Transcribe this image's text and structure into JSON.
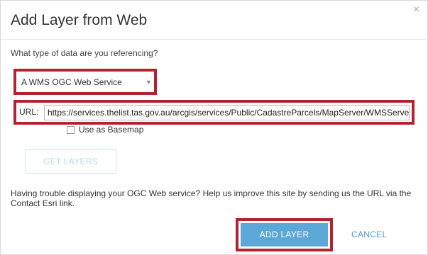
{
  "dialog": {
    "title": "Add Layer from Web",
    "close_glyph": "×",
    "question": "What type of data are you referencing?",
    "select": {
      "selected": "A WMS OGC Web Service",
      "caret_glyph": "▼"
    },
    "url": {
      "label": "URL:",
      "value": "https://services.thelist.tas.gov.au/arcgis/services/Public/CadastreParcels/MapServer/WMSServer"
    },
    "basemap": {
      "label": "Use as Basemap",
      "checked": false
    },
    "get_layers_label": "GET LAYERS",
    "help_text": "Having trouble displaying your OGC Web service? Help us improve this site by sending us the URL via the Contact Esri link.",
    "add_layer_label": "ADD LAYER",
    "cancel_label": "CANCEL"
  },
  "colors": {
    "highlight": "#b0232f",
    "primary_button": "#5aa7d8",
    "link": "#4a9cd1",
    "disabled_button_text": "#b9d7ea"
  }
}
